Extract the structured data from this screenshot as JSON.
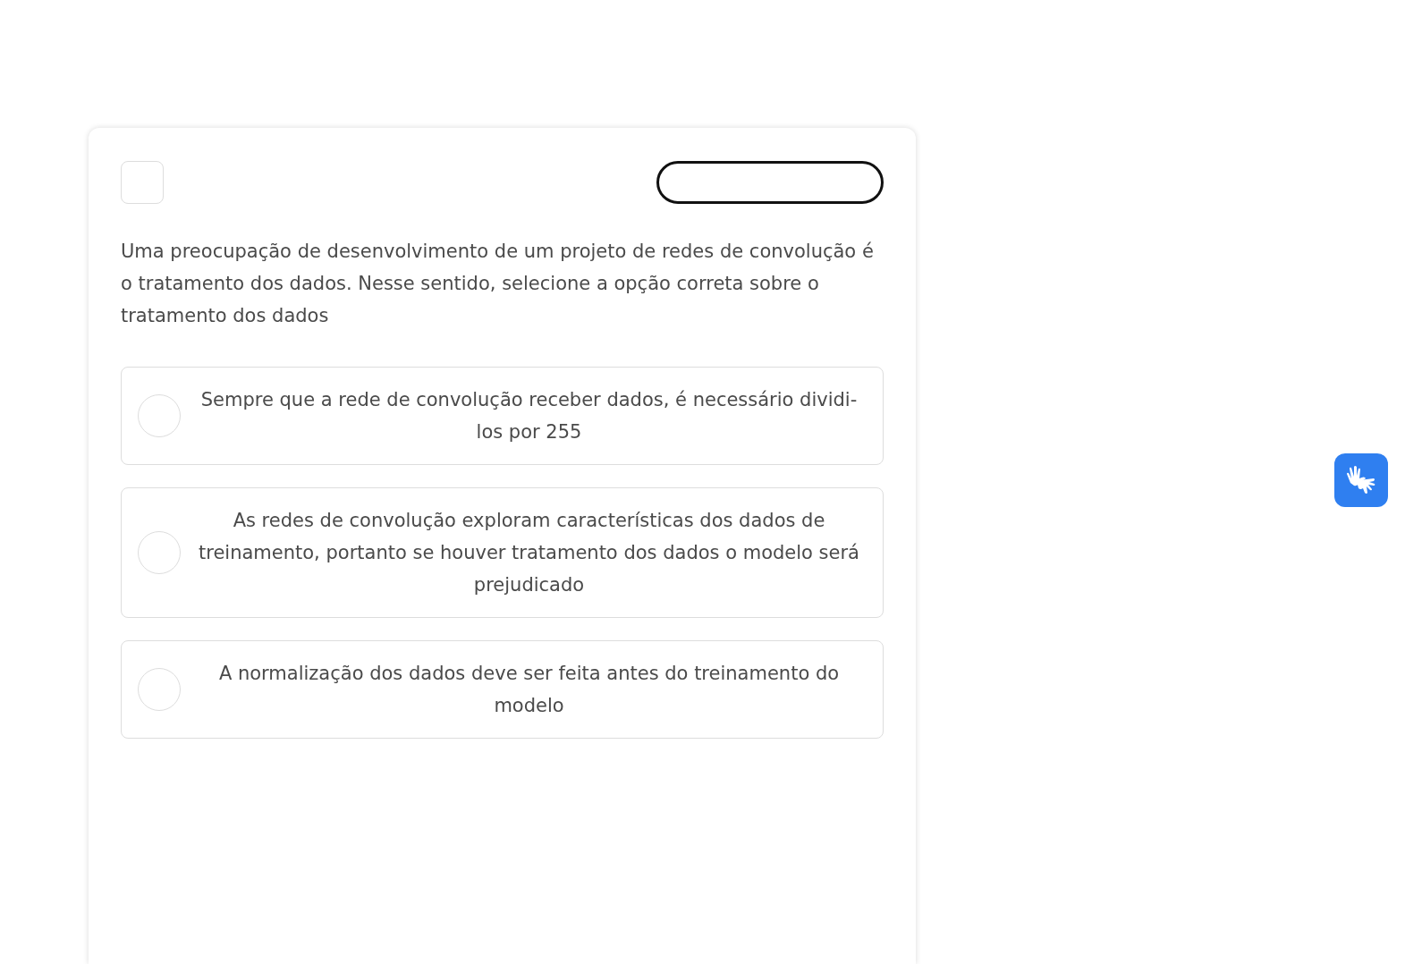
{
  "checkbox": {
    "checked": false
  },
  "question": "Uma preocupação de desenvolvimento de um projeto de redes de convolução é o tratamento dos dados. Nesse sentido, selecione a opção correta sobre o tratamento dos dados",
  "options": [
    {
      "text": "Sempre que a rede de convolução receber dados, é necessário dividi-los por 255",
      "selected": false
    },
    {
      "text": "As redes de convolução exploram características dos dados de treinamento, portanto se houver tratamento dos dados o modelo será prejudicado",
      "selected": false
    },
    {
      "text": "A normalização dos dados deve ser feita antes do treinamento do modelo",
      "selected": false
    }
  ]
}
